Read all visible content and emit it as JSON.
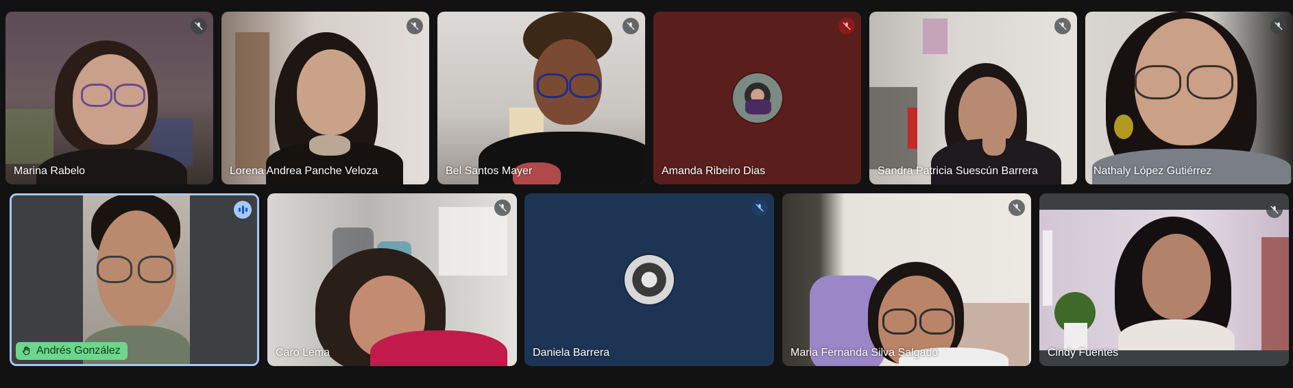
{
  "participants_row1": [
    {
      "name": "Marina Rabelo",
      "mic": "muted"
    },
    {
      "name": "Lorena Andrea Panche Veloza",
      "mic": "muted"
    },
    {
      "name": "Bel Santos Mayer",
      "mic": "muted"
    },
    {
      "name": "Amanda Ribeiro Dias",
      "mic": "muted"
    },
    {
      "name": "Sandra Patricia Suescún Barrera",
      "mic": "muted"
    },
    {
      "name": "Nathaly López Gutiérrez",
      "mic": "muted"
    }
  ],
  "participants_row2": [
    {
      "name": "Andrés González",
      "mic": "speaking"
    },
    {
      "name": "Caro Lema",
      "mic": "muted"
    },
    {
      "name": "Daniela Barrera",
      "mic": "muted"
    },
    {
      "name": "Maria Fernanda Silva Salgado",
      "mic": "muted"
    },
    {
      "name": "Cindy Fuentes",
      "mic": "muted"
    }
  ],
  "colors": {
    "background": "#121212",
    "active_speaker_border": "#a8c7fa",
    "speaking_chip": "#6dd58c",
    "muted_red": "#8b1a1a",
    "daniela_tile": "#1e3454",
    "amanda_tile": "#5a1f1d"
  },
  "icons": {
    "mic_muted": "mic-off-icon",
    "speaking": "audio-levels-icon",
    "hand": "hand-icon"
  }
}
